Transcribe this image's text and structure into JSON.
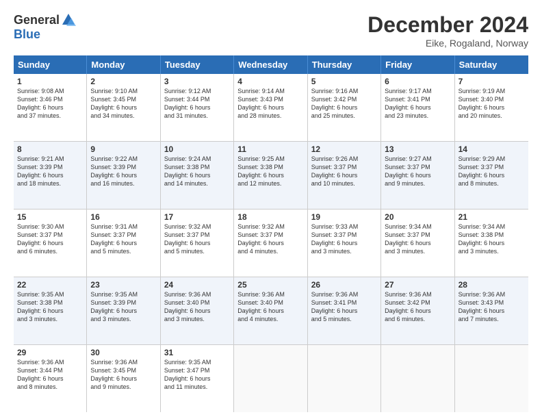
{
  "header": {
    "logo_general": "General",
    "logo_blue": "Blue",
    "month_title": "December 2024",
    "location": "Eike, Rogaland, Norway"
  },
  "days_of_week": [
    "Sunday",
    "Monday",
    "Tuesday",
    "Wednesday",
    "Thursday",
    "Friday",
    "Saturday"
  ],
  "weeks": [
    [
      {
        "day": "1",
        "lines": [
          "Sunrise: 9:08 AM",
          "Sunset: 3:46 PM",
          "Daylight: 6 hours",
          "and 37 minutes."
        ]
      },
      {
        "day": "2",
        "lines": [
          "Sunrise: 9:10 AM",
          "Sunset: 3:45 PM",
          "Daylight: 6 hours",
          "and 34 minutes."
        ]
      },
      {
        "day": "3",
        "lines": [
          "Sunrise: 9:12 AM",
          "Sunset: 3:44 PM",
          "Daylight: 6 hours",
          "and 31 minutes."
        ]
      },
      {
        "day": "4",
        "lines": [
          "Sunrise: 9:14 AM",
          "Sunset: 3:43 PM",
          "Daylight: 6 hours",
          "and 28 minutes."
        ]
      },
      {
        "day": "5",
        "lines": [
          "Sunrise: 9:16 AM",
          "Sunset: 3:42 PM",
          "Daylight: 6 hours",
          "and 25 minutes."
        ]
      },
      {
        "day": "6",
        "lines": [
          "Sunrise: 9:17 AM",
          "Sunset: 3:41 PM",
          "Daylight: 6 hours",
          "and 23 minutes."
        ]
      },
      {
        "day": "7",
        "lines": [
          "Sunrise: 9:19 AM",
          "Sunset: 3:40 PM",
          "Daylight: 6 hours",
          "and 20 minutes."
        ]
      }
    ],
    [
      {
        "day": "8",
        "lines": [
          "Sunrise: 9:21 AM",
          "Sunset: 3:39 PM",
          "Daylight: 6 hours",
          "and 18 minutes."
        ]
      },
      {
        "day": "9",
        "lines": [
          "Sunrise: 9:22 AM",
          "Sunset: 3:39 PM",
          "Daylight: 6 hours",
          "and 16 minutes."
        ]
      },
      {
        "day": "10",
        "lines": [
          "Sunrise: 9:24 AM",
          "Sunset: 3:38 PM",
          "Daylight: 6 hours",
          "and 14 minutes."
        ]
      },
      {
        "day": "11",
        "lines": [
          "Sunrise: 9:25 AM",
          "Sunset: 3:38 PM",
          "Daylight: 6 hours",
          "and 12 minutes."
        ]
      },
      {
        "day": "12",
        "lines": [
          "Sunrise: 9:26 AM",
          "Sunset: 3:37 PM",
          "Daylight: 6 hours",
          "and 10 minutes."
        ]
      },
      {
        "day": "13",
        "lines": [
          "Sunrise: 9:27 AM",
          "Sunset: 3:37 PM",
          "Daylight: 6 hours",
          "and 9 minutes."
        ]
      },
      {
        "day": "14",
        "lines": [
          "Sunrise: 9:29 AM",
          "Sunset: 3:37 PM",
          "Daylight: 6 hours",
          "and 8 minutes."
        ]
      }
    ],
    [
      {
        "day": "15",
        "lines": [
          "Sunrise: 9:30 AM",
          "Sunset: 3:37 PM",
          "Daylight: 6 hours",
          "and 6 minutes."
        ]
      },
      {
        "day": "16",
        "lines": [
          "Sunrise: 9:31 AM",
          "Sunset: 3:37 PM",
          "Daylight: 6 hours",
          "and 5 minutes."
        ]
      },
      {
        "day": "17",
        "lines": [
          "Sunrise: 9:32 AM",
          "Sunset: 3:37 PM",
          "Daylight: 6 hours",
          "and 5 minutes."
        ]
      },
      {
        "day": "18",
        "lines": [
          "Sunrise: 9:32 AM",
          "Sunset: 3:37 PM",
          "Daylight: 6 hours",
          "and 4 minutes."
        ]
      },
      {
        "day": "19",
        "lines": [
          "Sunrise: 9:33 AM",
          "Sunset: 3:37 PM",
          "Daylight: 6 hours",
          "and 3 minutes."
        ]
      },
      {
        "day": "20",
        "lines": [
          "Sunrise: 9:34 AM",
          "Sunset: 3:37 PM",
          "Daylight: 6 hours",
          "and 3 minutes."
        ]
      },
      {
        "day": "21",
        "lines": [
          "Sunrise: 9:34 AM",
          "Sunset: 3:38 PM",
          "Daylight: 6 hours",
          "and 3 minutes."
        ]
      }
    ],
    [
      {
        "day": "22",
        "lines": [
          "Sunrise: 9:35 AM",
          "Sunset: 3:38 PM",
          "Daylight: 6 hours",
          "and 3 minutes."
        ]
      },
      {
        "day": "23",
        "lines": [
          "Sunrise: 9:35 AM",
          "Sunset: 3:39 PM",
          "Daylight: 6 hours",
          "and 3 minutes."
        ]
      },
      {
        "day": "24",
        "lines": [
          "Sunrise: 9:36 AM",
          "Sunset: 3:40 PM",
          "Daylight: 6 hours",
          "and 3 minutes."
        ]
      },
      {
        "day": "25",
        "lines": [
          "Sunrise: 9:36 AM",
          "Sunset: 3:40 PM",
          "Daylight: 6 hours",
          "and 4 minutes."
        ]
      },
      {
        "day": "26",
        "lines": [
          "Sunrise: 9:36 AM",
          "Sunset: 3:41 PM",
          "Daylight: 6 hours",
          "and 5 minutes."
        ]
      },
      {
        "day": "27",
        "lines": [
          "Sunrise: 9:36 AM",
          "Sunset: 3:42 PM",
          "Daylight: 6 hours",
          "and 6 minutes."
        ]
      },
      {
        "day": "28",
        "lines": [
          "Sunrise: 9:36 AM",
          "Sunset: 3:43 PM",
          "Daylight: 6 hours",
          "and 7 minutes."
        ]
      }
    ],
    [
      {
        "day": "29",
        "lines": [
          "Sunrise: 9:36 AM",
          "Sunset: 3:44 PM",
          "Daylight: 6 hours",
          "and 8 minutes."
        ]
      },
      {
        "day": "30",
        "lines": [
          "Sunrise: 9:36 AM",
          "Sunset: 3:45 PM",
          "Daylight: 6 hours",
          "and 9 minutes."
        ]
      },
      {
        "day": "31",
        "lines": [
          "Sunrise: 9:35 AM",
          "Sunset: 3:47 PM",
          "Daylight: 6 hours",
          "and 11 minutes."
        ]
      },
      {
        "day": "",
        "lines": []
      },
      {
        "day": "",
        "lines": []
      },
      {
        "day": "",
        "lines": []
      },
      {
        "day": "",
        "lines": []
      }
    ]
  ]
}
